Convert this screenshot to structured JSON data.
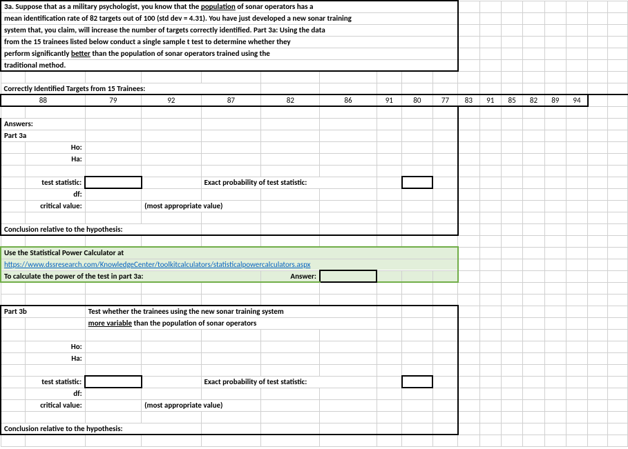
{
  "q": {
    "line1a": "3a. Suppose that as a military psychologist, you know that the ",
    "line1b": "population",
    "line1c": " of sonar operators has a",
    "line2": "mean identification rate of 82 targets out of 100 (std dev = 4.31).  You have just developed a new sonar training",
    "line3": "system that, you claim, will increase the number of targets correctly identified.  Part 3a: Using the data",
    "line4": "from the 15 trainees listed below conduct a single sample t test to determine whether they",
    "line5a": "perform significantly ",
    "line5b": "better",
    "line5c": " than the population of sonar operators trained using the",
    "line6": "traditional method."
  },
  "dataHeader": "Correctly Identified Targets from 15 Trainees:",
  "trainees": [
    "88",
    "79",
    "92",
    "87",
    "82",
    "86",
    "91",
    "80",
    "77",
    "83",
    "91",
    "85",
    "82",
    "89",
    "94"
  ],
  "labels": {
    "answers": "Answers:",
    "part3a": "Part 3a",
    "ho": "Ho:",
    "ha": "Ha:",
    "testStat": "test statistic:",
    "df": "df:",
    "crit": "critical value:",
    "exactProb": "Exact probability of test statistic:",
    "mostApprop": "(most appropriate value)",
    "conclusion": "Conclusion relative to the hypothesis:",
    "calcLine1": "Use the Statistical Power Calculator at",
    "calcLink": "https://www.dssresearch.com/KnowledgeCenter/toolkitcalculators/statisticalpowercalculators.aspx",
    "calcLine3": "To calculate the power of the test in part 3a:",
    "answer": "Answer:",
    "part3b": "Part 3b",
    "part3bLine1": "Test whether the trainees using the new sonar training system",
    "part3bLine2a": "more variable",
    "part3bLine2b": " than the population of sonar operators"
  }
}
